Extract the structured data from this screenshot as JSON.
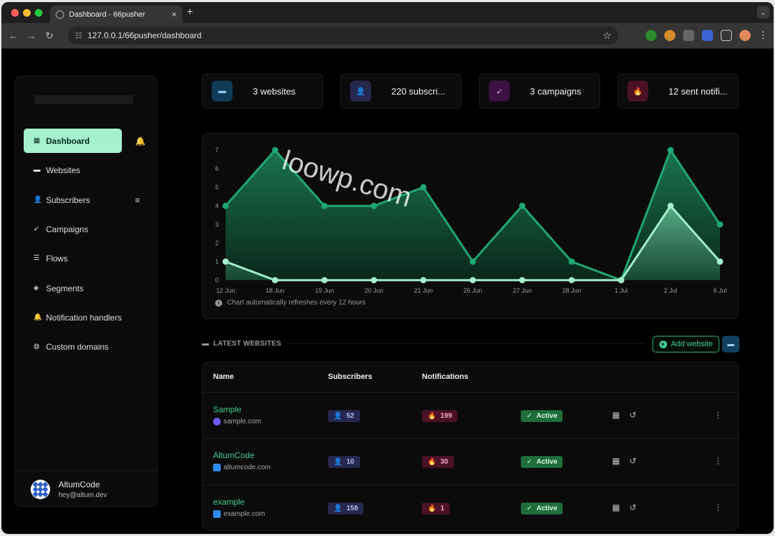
{
  "browser": {
    "tab_title": "Dashboard - 66pusher",
    "tab_close": "×",
    "new_tab": "+",
    "address": "127.0.0.1/66pusher/dashboard"
  },
  "sidebar": {
    "items": [
      {
        "label": "Dashboard",
        "icon": "dashboard-icon",
        "glyph": "▦",
        "active": true
      },
      {
        "label": "Websites",
        "icon": "website-icon",
        "glyph": "▬",
        "active": false
      },
      {
        "label": "Subscribers",
        "icon": "subscribers-icon",
        "glyph": "👤",
        "active": false
      },
      {
        "label": "Campaigns",
        "icon": "rocket-icon",
        "glyph": "➶",
        "active": false
      },
      {
        "label": "Flows",
        "icon": "flows-icon",
        "glyph": "☰",
        "active": false
      },
      {
        "label": "Segments",
        "icon": "layers-icon",
        "glyph": "◈",
        "active": false
      },
      {
        "label": "Notification handlers",
        "icon": "bell-icon",
        "glyph": "🔔",
        "active": false
      },
      {
        "label": "Custom domains",
        "icon": "globe-icon",
        "glyph": "◍",
        "active": false
      }
    ],
    "user": {
      "name": "AltumCode",
      "email": "hey@altum.dev"
    }
  },
  "stats": [
    {
      "label": "3 websites",
      "icon": "website-icon",
      "bg": "#0f3b57",
      "fg": "#8fd0f7"
    },
    {
      "label": "220 subscri...",
      "icon": "subscribers-icon",
      "bg": "#26284f",
      "fg": "#b9bcf5"
    },
    {
      "label": "3 campaigns",
      "icon": "rocket-icon",
      "bg": "#3b1242",
      "fg": "#e8a6f5"
    },
    {
      "label": "12 sent notifi...",
      "icon": "fire-icon",
      "bg": "#4a1127",
      "fg": "#f3a8c5"
    }
  ],
  "chart_data": {
    "type": "area",
    "categories": [
      "12 Jun",
      "18 Jun",
      "19 Jun",
      "20 Jun",
      "21 Jun",
      "26 Jun",
      "27 Jun",
      "28 Jun",
      "1 Jul",
      "2 Jul",
      "6 Jul"
    ],
    "series": [
      {
        "values": [
          4,
          7,
          4,
          4,
          5,
          1,
          4,
          1,
          0,
          7,
          3
        ],
        "color": "#1fa873"
      },
      {
        "values": [
          1,
          0,
          0,
          0,
          0,
          0,
          0,
          0,
          0,
          4,
          1
        ],
        "color": "#a5f0cd"
      }
    ],
    "yticks": [
      0,
      1,
      2,
      3,
      4,
      5,
      6,
      7
    ],
    "ylim": [
      0,
      7
    ],
    "grid": false,
    "note": "Chart automatically refreshes every 12 hours"
  },
  "watermark": "loowp.com",
  "latest": {
    "title": "LATEST WEBSITES",
    "add_label": "Add website",
    "columns": [
      "Name",
      "Subscribers",
      "Notifications"
    ],
    "rows": [
      {
        "name": "Sample",
        "domain": "sample.com",
        "subscribers": "52",
        "notifications": "199",
        "status": "Active"
      },
      {
        "name": "AltumCode",
        "domain": "altumcode.com",
        "subscribers": "10",
        "notifications": "30",
        "status": "Active"
      },
      {
        "name": "example",
        "domain": "example.com",
        "subscribers": "158",
        "notifications": "1",
        "status": "Active"
      }
    ]
  }
}
